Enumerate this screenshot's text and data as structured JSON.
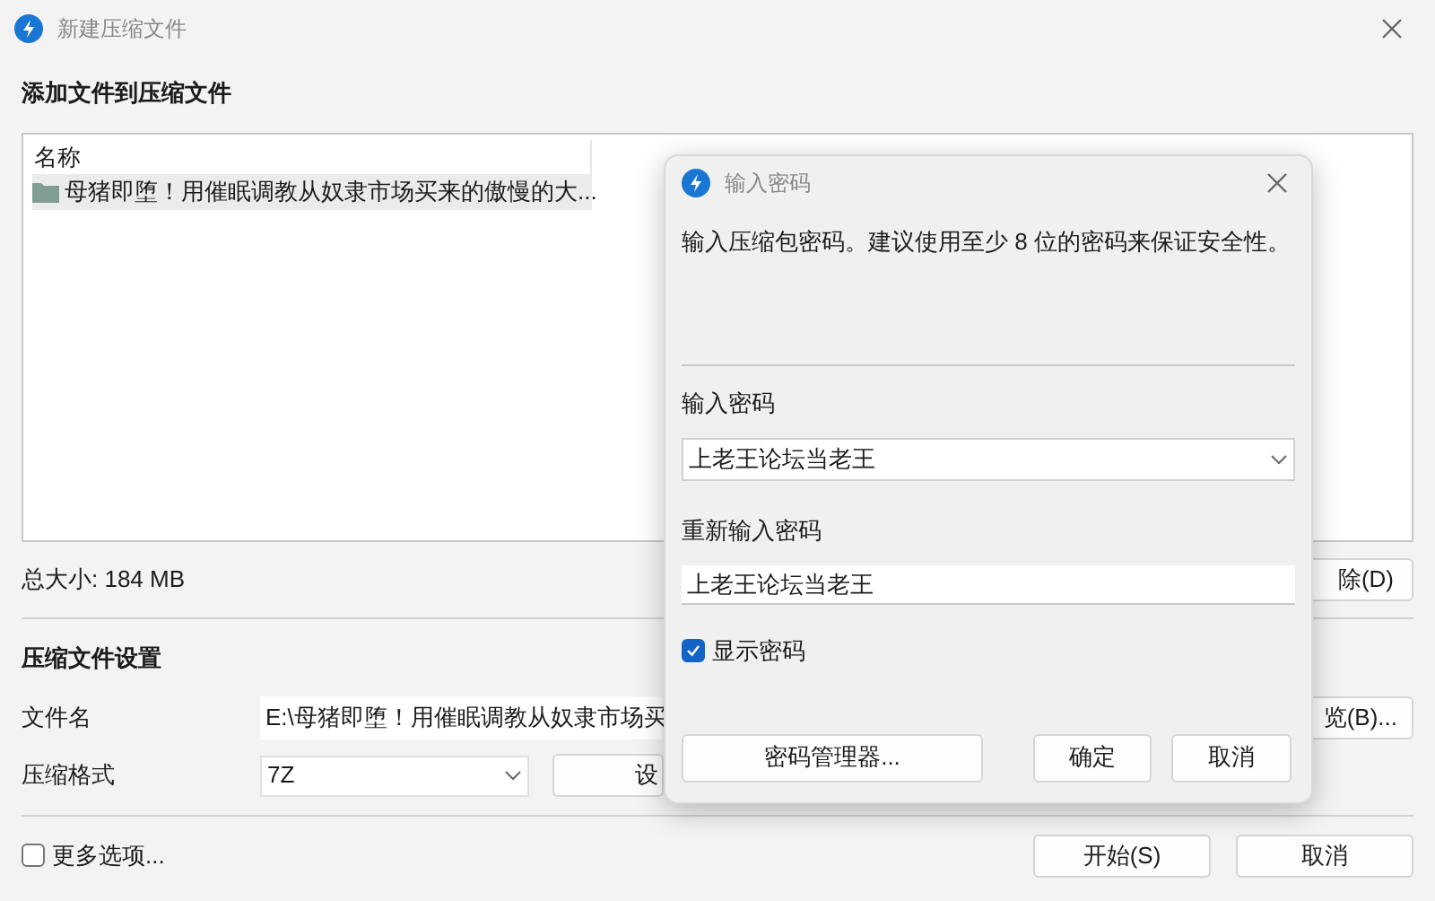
{
  "window": {
    "title": "新建压缩文件"
  },
  "add_section": {
    "heading": "添加文件到压缩文件",
    "columns": [
      "名称"
    ],
    "rows": [
      {
        "name": "母猪即堕！用催眠调教从奴隶市场买来的傲慢的大...",
        "kind": "folder",
        "selected": true
      }
    ],
    "total": "总大小: 184 MB",
    "delete_button": "除(D)"
  },
  "settings": {
    "heading": "压缩文件设置",
    "filename_label": "文件名",
    "filename_value": "E:\\母猪即堕！用催眠调教从奴隶市场买",
    "browse_button": "览(B)...",
    "format_label": "压缩格式",
    "format_value": "7Z",
    "settings_button": "设"
  },
  "more_options": {
    "label": "更多选项...",
    "checked": false
  },
  "buttons": [
    "开始(S)",
    "取消"
  ],
  "dialog": {
    "title": "输入密码",
    "message": "输入压缩包密码。建议使用至少 8 位的密码来保证安全性。",
    "password_label": "输入密码",
    "password_value": "上老王论坛当老王",
    "confirm_label": "重新输入密码",
    "confirm_value": "上老王论坛当老王",
    "show_password": {
      "label": "显示密码",
      "checked": true
    },
    "buttons": [
      "密码管理器...",
      "确定",
      "取消"
    ]
  }
}
